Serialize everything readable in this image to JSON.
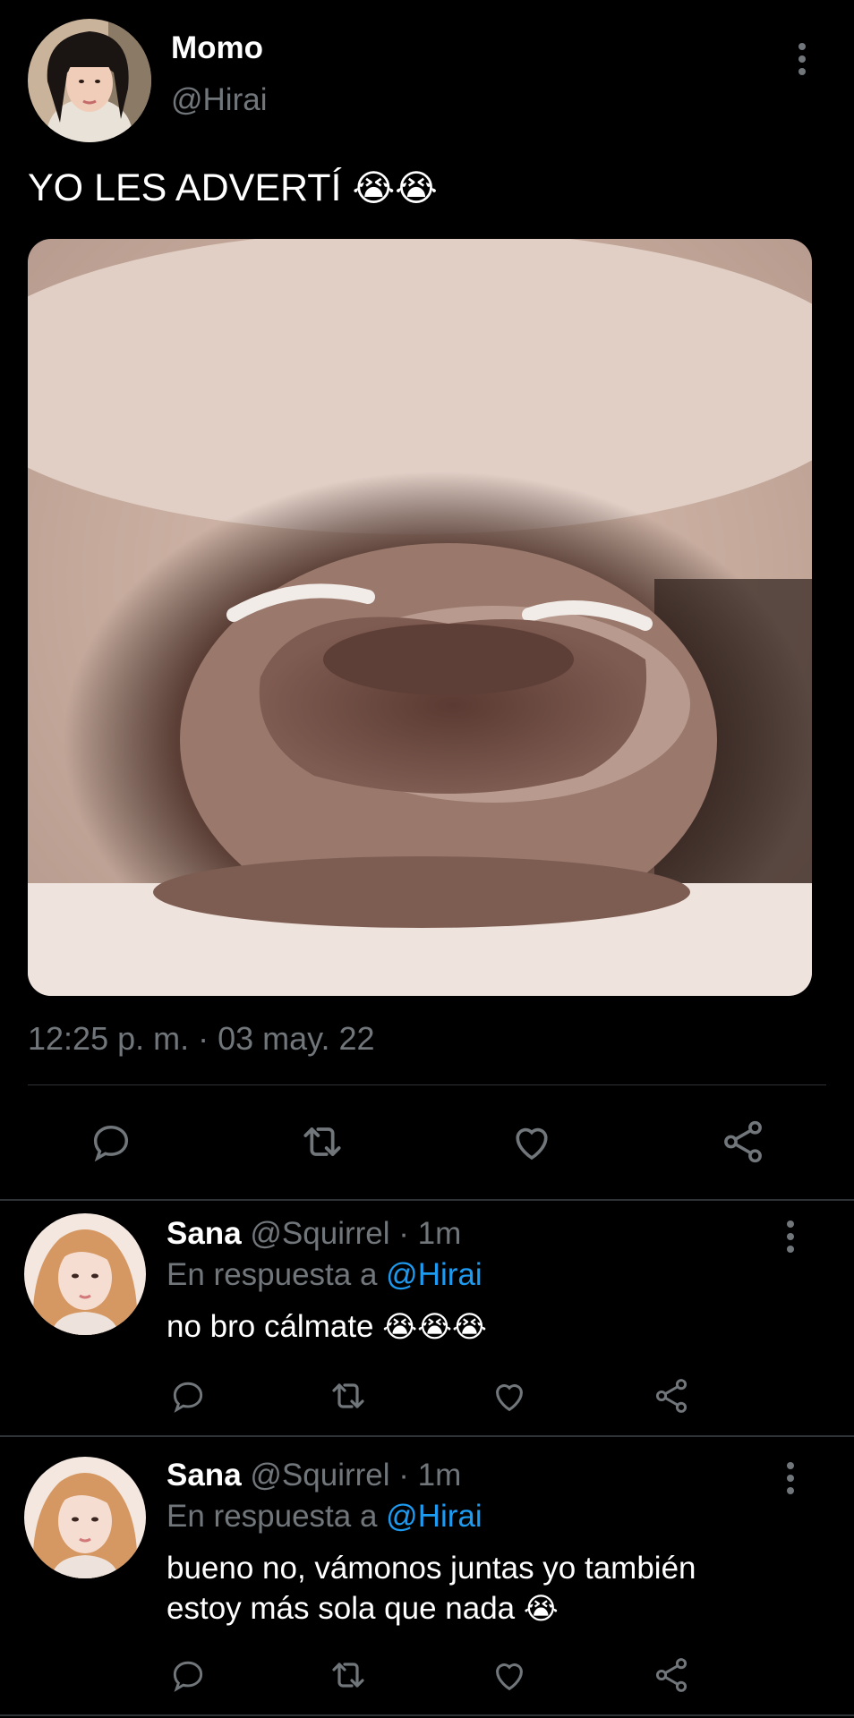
{
  "tweet": {
    "author_name": "Momo",
    "author_handle": "@Hirai",
    "text": "YO LES ADVERTÍ",
    "text_emoji": "😭😭",
    "timestamp": "12:25 p. m. · 03 may. 22",
    "actions": [
      "reply-icon",
      "retweet-icon",
      "like-icon",
      "share-icon"
    ]
  },
  "replies": [
    {
      "author_name": "Sana",
      "author_handle": "@Squirrel",
      "separator": "·",
      "time": "1m",
      "reply_prefix": "En respuesta a",
      "reply_to": "@Hirai",
      "text": "no bro cálmate",
      "text_emoji": "😭😭😭"
    },
    {
      "author_name": "Sana",
      "author_handle": "@Squirrel",
      "separator": "·",
      "time": "1m",
      "reply_prefix": "En respuesta a",
      "reply_to": "@Hirai",
      "text": "bueno no, vámonos juntas yo también estoy más sola que nada",
      "text_emoji": "😭"
    }
  ],
  "colors": {
    "background": "#000000",
    "text_primary": "#ffffff",
    "text_secondary": "#71767b",
    "link": "#1d9bf0",
    "divider": "#2f3336"
  }
}
